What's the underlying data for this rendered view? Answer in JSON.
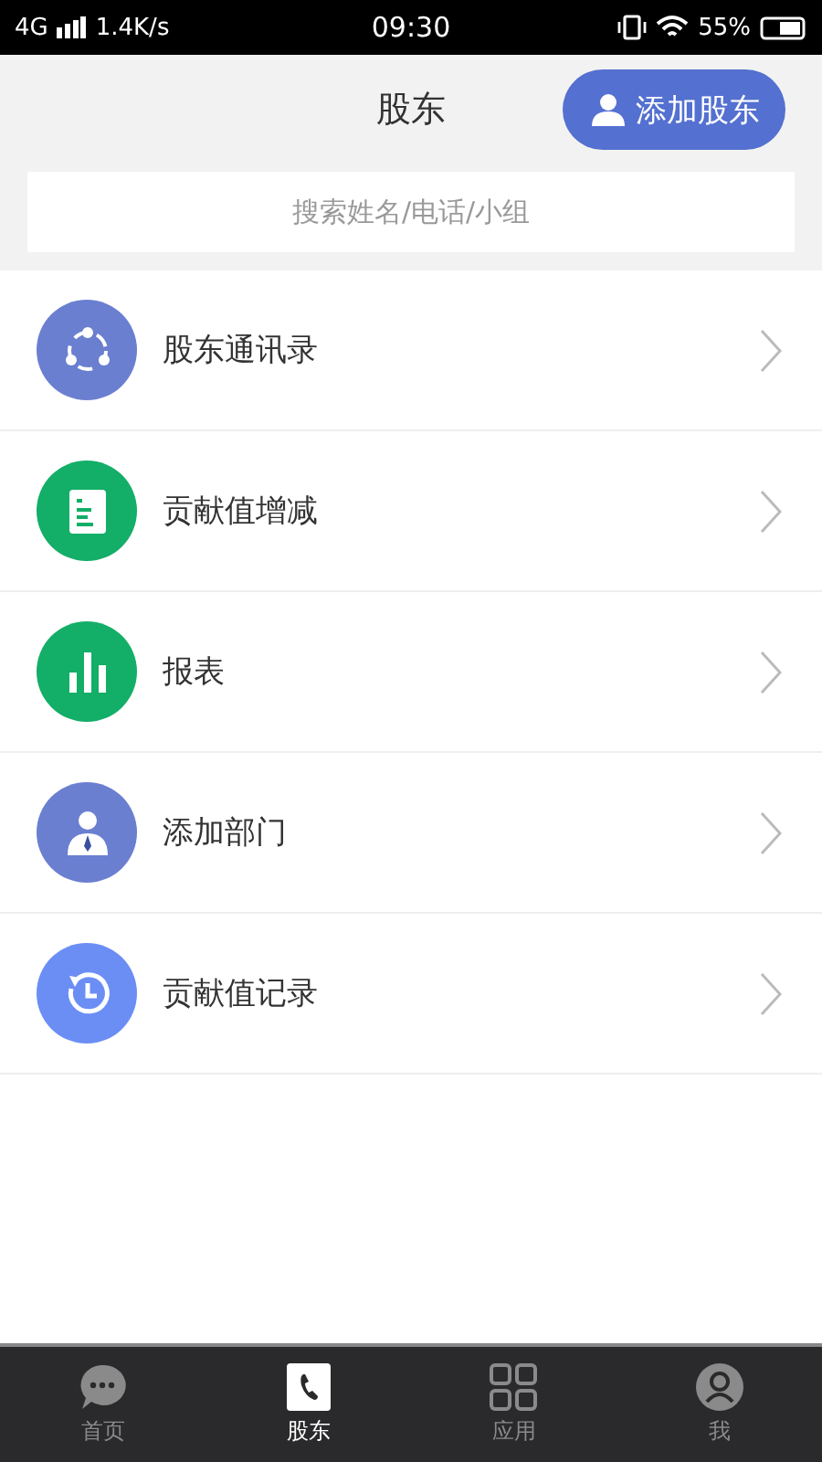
{
  "status_bar": {
    "network": "4G",
    "speed": "1.4K/s",
    "time": "09:30",
    "battery": "55%"
  },
  "header": {
    "title": "股东",
    "add_button": "添加股东"
  },
  "search": {
    "placeholder": "搜索姓名/电话/小组"
  },
  "menu": [
    {
      "label": "股东通讯录",
      "kind": "share",
      "color": "#6b7fd0"
    },
    {
      "label": "贡献值增减",
      "kind": "doc",
      "color": "#13ae67"
    },
    {
      "label": "报表",
      "kind": "chart",
      "color": "#13ae67"
    },
    {
      "label": "添加部门",
      "kind": "person",
      "color": "#6b7fd0"
    },
    {
      "label": "贡献值记录",
      "kind": "history",
      "color": "#6b8ef5"
    }
  ],
  "tabs": [
    {
      "label": "首页",
      "kind": "chat",
      "selected": false
    },
    {
      "label": "股东",
      "kind": "contacts",
      "selected": true
    },
    {
      "label": "应用",
      "kind": "grid",
      "selected": false
    },
    {
      "label": "我",
      "kind": "profile",
      "selected": false
    }
  ]
}
